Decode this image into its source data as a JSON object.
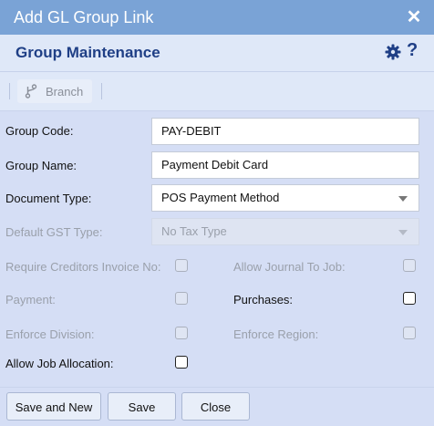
{
  "dialog": {
    "title": "Add GL Group Link",
    "close_glyph": "✕"
  },
  "header": {
    "title": "Group Maintenance",
    "settings_icon": "gear-icon",
    "help_glyph": "?"
  },
  "toolbar": {
    "branch_label": "Branch",
    "branch_icon": "branch-icon"
  },
  "form": {
    "group_code": {
      "label": "Group Code:",
      "value": "PAY-DEBIT"
    },
    "group_name": {
      "label": "Group Name:",
      "value": "Payment Debit Card"
    },
    "document_type": {
      "label": "Document Type:",
      "value": "POS Payment Method"
    },
    "default_gst_type": {
      "label": "Default GST Type:",
      "value": "No Tax Type",
      "disabled": true
    },
    "require_creditors_invoice_no": {
      "label": "Require Creditors Invoice No:",
      "checked": false,
      "disabled": true
    },
    "allow_journal_to_job": {
      "label": "Allow Journal To Job:",
      "checked": false,
      "disabled": true
    },
    "payment": {
      "label": "Payment:",
      "checked": false,
      "disabled": true
    },
    "purchases": {
      "label": "Purchases:",
      "checked": false,
      "disabled": false
    },
    "enforce_division": {
      "label": "Enforce Division:",
      "checked": false,
      "disabled": true
    },
    "enforce_region": {
      "label": "Enforce Region:",
      "checked": false,
      "disabled": true
    },
    "allow_job_allocation": {
      "label": "Allow Job Allocation:",
      "checked": false,
      "disabled": false
    }
  },
  "footer": {
    "save_and_new": "Save and New",
    "save": "Save",
    "close": "Close"
  },
  "colors": {
    "titlebar": "#7aa3d6",
    "header_text": "#1f3f86",
    "panel": "#d5def5"
  }
}
